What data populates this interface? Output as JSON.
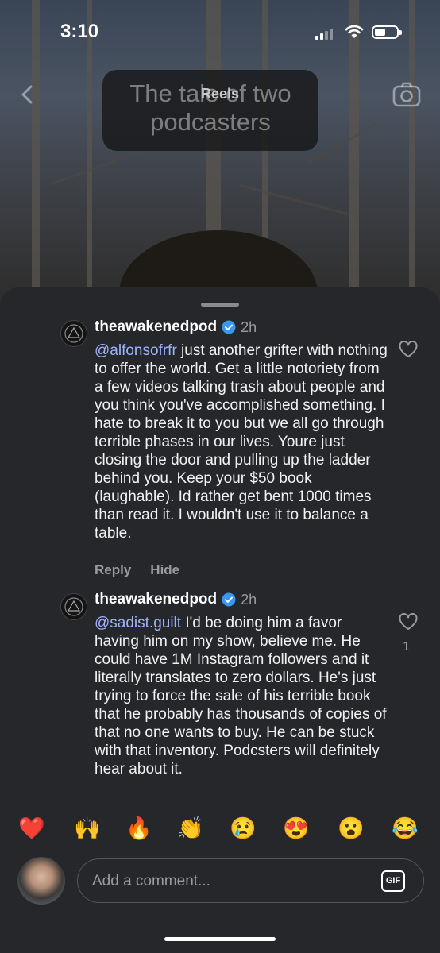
{
  "status_bar": {
    "time": "3:10"
  },
  "header": {
    "title": "Reels",
    "caption": "The tale of two podcasters"
  },
  "comments": [
    {
      "username": "theawakenedpod",
      "timestamp": "2h",
      "mention": "@alfonsofrfr",
      "text": " just another grifter with nothing to offer the world. Get a little notoriety from a few videos talking trash about people and you think you've accomplished something. I hate to break it to you but we all go through terrible phases in our lives. Youre just closing the door and pulling up the ladder behind you. Keep your $50 book (laughable). Id rather get bent 1000 times than read it. I wouldn't use it to balance a table.",
      "reply_label": "Reply",
      "hide_label": "Hide",
      "likes": ""
    },
    {
      "username": "theawakenedpod",
      "timestamp": "2h",
      "mention": "@sadist.guilt",
      "text": " I'd be doing him a favor having him on my show, believe me. He could have 1M Instagram followers and it literally translates to zero dollars. He's just trying to force the sale of his terrible book that he probably has thousands of copies of that no one wants to buy. He can be stuck with that inventory. Podcsters will definitely hear about it.",
      "likes": "1"
    }
  ],
  "emoji_bar": [
    "❤️",
    "🙌",
    "🔥",
    "👏",
    "😢",
    "😍",
    "😮",
    "😂"
  ],
  "composer": {
    "placeholder": "Add a comment...",
    "gif_label": "GIF"
  },
  "colors": {
    "sheet": "#25272b",
    "mention": "#9fb3ff",
    "verified": "#3897f0",
    "secondary_text": "#9b9b9f"
  }
}
